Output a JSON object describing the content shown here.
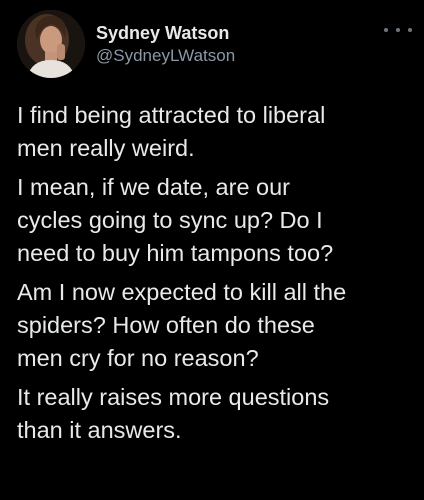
{
  "author": {
    "name": "Sydney Watson",
    "handle": "@SydneyLWatson",
    "avatar_icon": "profile-photo"
  },
  "menu_icon": "more-options-icon",
  "colors": {
    "background": "#000000",
    "text_primary": "#e7e9ea",
    "text_secondary": "#8b98a5"
  },
  "tweet": {
    "paragraphs": [
      "I find being attracted to liberal\nmen really weird.",
      "I mean, if we date, are our\ncycles going to sync up? Do I\nneed to buy him tampons too?",
      "Am I now expected to kill all the\nspiders? How often do these\nmen cry for no reason?",
      "It really raises more questions\nthan it answers."
    ]
  }
}
